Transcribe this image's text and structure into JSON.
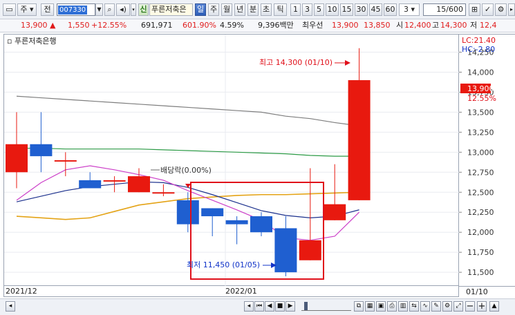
{
  "toolbar": {
    "market_label": "주",
    "prev_label": "전",
    "code": "007330",
    "signal_label": "신",
    "stock_name": "푸른저축은",
    "periods": [
      "일",
      "주",
      "월",
      "년",
      "분",
      "초",
      "틱"
    ],
    "active_period": "일",
    "minute_steps": [
      "1",
      "3",
      "5",
      "10",
      "15",
      "30",
      "45",
      "60"
    ],
    "step_value": "3",
    "count_value": "15/600",
    "search_icon": "search-icon",
    "settings_icon": "gear-icon"
  },
  "quote": {
    "price": "13,900",
    "arrow": "▲",
    "change": "1,550",
    "change_pct": "+12.55%",
    "volume": "691,971",
    "volume_ratio": "601.90%",
    "turnover": "4.59%",
    "amount": "9,396백만",
    "priority_label": "최우선",
    "ask": "13,900",
    "bid": "13,850",
    "open_label": "시",
    "open": "12,400",
    "high_label": "고",
    "high": "14,300",
    "low_label": "저",
    "low": "12,4"
  },
  "chart": {
    "title": "푸른저축은행",
    "lc_label": "LC:21.40",
    "hc_label": "HC:-2.80",
    "price_label": "13,900",
    "price_pct": "12.55%",
    "high_annotation": "최고 14,300 (01/10)",
    "low_annotation": "최저 11,450 (01/05)",
    "dividend_annotation": "배당락(0.00%)",
    "date_left": "2021/12",
    "date_mid": "2022/01",
    "date_right": "01/10",
    "colors": {
      "up": "#e8190f",
      "down": "#1f5fd0",
      "ma5": "#cc3fc8",
      "ma20": "#1a2f8c",
      "ma60": "#e4a316",
      "ma120": "#2b9a45",
      "ma240": "#7d7d7d"
    }
  },
  "chart_data": {
    "type": "candlestick",
    "title": "푸른저축은행",
    "y_ticks": [
      11500,
      11750,
      12000,
      12250,
      12500,
      12750,
      13000,
      13250,
      13500,
      13750,
      14000,
      14250
    ],
    "y_range": [
      11320,
      14470
    ],
    "candles": [
      {
        "open": 12750,
        "close": 13100,
        "high": 13500,
        "low": 12550
      },
      {
        "open": 13100,
        "close": 12950,
        "high": 13500,
        "low": 12750
      },
      {
        "open": 12900,
        "close": 12900,
        "high": 13000,
        "low": 12700
      },
      {
        "open": 12650,
        "close": 12550,
        "high": 12750,
        "low": 12550
      },
      {
        "open": 12650,
        "close": 12650,
        "high": 12700,
        "low": 12500
      },
      {
        "open": 12500,
        "close": 12700,
        "high": 12800,
        "low": 12500
      },
      {
        "open": 12500,
        "close": 12500,
        "high": 12600,
        "low": 12450
      },
      {
        "open": 12400,
        "close": 12100,
        "high": 12500,
        "low": 12000
      },
      {
        "open": 12300,
        "close": 12200,
        "high": 12300,
        "low": 11950
      },
      {
        "open": 12150,
        "close": 12100,
        "high": 12200,
        "low": 11850
      },
      {
        "open": 12200,
        "close": 12000,
        "high": 12250,
        "low": 11950
      },
      {
        "open": 12050,
        "close": 11500,
        "high": 12200,
        "low": 11450
      },
      {
        "open": 11650,
        "close": 11900,
        "high": 12800,
        "low": 11650
      },
      {
        "open": 12150,
        "close": 12350,
        "high": 12850,
        "low": 12150
      },
      {
        "open": 12400,
        "close": 13900,
        "high": 14300,
        "low": 12400
      }
    ],
    "moving_averages": [
      {
        "name": "ma240",
        "values": [
          13700,
          13680,
          13660,
          13640,
          13620,
          13600,
          13580,
          13560,
          13540,
          13520,
          13500,
          13450,
          13420,
          13370,
          13330
        ]
      },
      {
        "name": "ma120",
        "values": [
          13050,
          13050,
          13040,
          13040,
          13040,
          13040,
          13030,
          13020,
          13010,
          13000,
          12990,
          12980,
          12960,
          12950,
          12950
        ]
      },
      {
        "name": "ma60",
        "values": [
          12200,
          12180,
          12160,
          12180,
          12260,
          12340,
          12380,
          12420,
          12440,
          12460,
          12470,
          12470,
          12480,
          12490,
          12500
        ]
      },
      {
        "name": "ma20",
        "values": [
          12380,
          12450,
          12520,
          12570,
          12600,
          12630,
          12620,
          12560,
          12470,
          12370,
          12270,
          12210,
          12180,
          12200,
          12280
        ]
      },
      {
        "name": "ma5",
        "values": [
          12400,
          12620,
          12780,
          12830,
          12780,
          12720,
          12650,
          12520,
          12400,
          12280,
          12150,
          11930,
          11900,
          11950,
          12250
        ]
      }
    ]
  },
  "bottom": {
    "zoom_out": "−",
    "zoom_in": "+",
    "add": "▲"
  }
}
